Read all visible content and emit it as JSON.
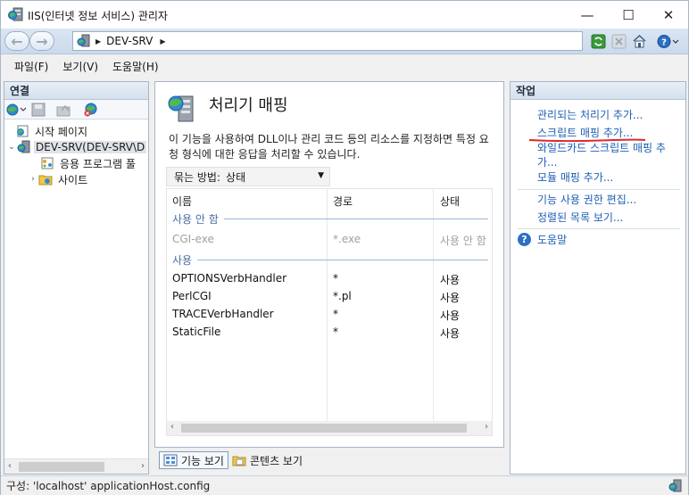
{
  "window": {
    "title": "IIS(인터넷 정보 서비스) 관리자",
    "minimize": "—",
    "maximize": "☐",
    "close": "✕"
  },
  "address": {
    "back": "←",
    "forward": "→",
    "path": "DEV-SRV"
  },
  "menu": [
    "파일(F)",
    "보기(V)",
    "도움말(H)"
  ],
  "connections": {
    "header": "연결",
    "tree": [
      {
        "label": "시작 페이지"
      },
      {
        "label": "DEV-SRV(DEV-SRV\\D"
      },
      {
        "label": "응용 프로그램 풀"
      },
      {
        "label": "사이트"
      }
    ]
  },
  "feature": {
    "title": "처리기 매핑",
    "description": "이 기능을 사용하여 DLL이나 관리 코드 등의 리소스를 지정하면 특정 요청 형식에 대한 응답을 처리할 수 있습니다.",
    "group_by_label": "묶는 방법:",
    "group_by_value": "상태",
    "columns": [
      "이름",
      "경로",
      "상태"
    ],
    "groups": [
      {
        "name": "사용 안 함",
        "rows": [
          {
            "name": "CGI-exe",
            "path": "*.exe",
            "state": "사용 안 함"
          }
        ]
      },
      {
        "name": "사용",
        "rows": [
          {
            "name": "OPTIONSVerbHandler",
            "path": "*",
            "state": "사용"
          },
          {
            "name": "PerlCGI",
            "path": "*.pl",
            "state": "사용"
          },
          {
            "name": "TRACEVerbHandler",
            "path": "*",
            "state": "사용"
          },
          {
            "name": "StaticFile",
            "path": "*",
            "state": "사용"
          }
        ]
      }
    ]
  },
  "view_tabs": {
    "features": "기능 보기",
    "content": "콘텐츠 보기"
  },
  "actions": {
    "header": "작업",
    "links": [
      "관리되는 처리기 추가...",
      "스크립트 매핑 추가...",
      "와일드카드 스크립트 매핑 추가...",
      "모듈 매핑 추가...",
      "기능 사용 권한 편집...",
      "정렬된 목록 보기...",
      "도움말"
    ]
  },
  "status": {
    "text": "구성: 'localhost' applicationHost.config"
  },
  "colors": {
    "link": "#1e5fb4",
    "annotation_underline": "#e0282e",
    "group_header": "#4a6fa5"
  }
}
